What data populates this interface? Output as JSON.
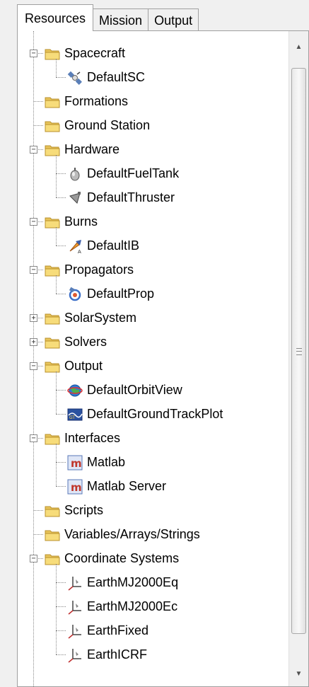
{
  "tabs": [
    "Resources",
    "Mission",
    "Output"
  ],
  "tree": [
    {
      "label": "Spacecraft",
      "icon": "folder-icon",
      "level": 0,
      "expanded": true
    },
    {
      "label": "DefaultSC",
      "icon": "satellite-icon",
      "level": 1
    },
    {
      "label": "Formations",
      "icon": "folder-icon",
      "level": 0
    },
    {
      "label": "Ground Station",
      "icon": "folder-icon",
      "level": 0
    },
    {
      "label": "Hardware",
      "icon": "folder-icon",
      "level": 0,
      "expanded": true
    },
    {
      "label": "DefaultFuelTank",
      "icon": "fuel-tank-icon",
      "level": 1
    },
    {
      "label": "DefaultThruster",
      "icon": "thruster-icon",
      "level": 1
    },
    {
      "label": "Burns",
      "icon": "folder-icon",
      "level": 0,
      "expanded": true
    },
    {
      "label": "DefaultIB",
      "icon": "impulsive-burn-icon",
      "level": 1
    },
    {
      "label": "Propagators",
      "icon": "folder-icon",
      "level": 0,
      "expanded": true
    },
    {
      "label": "DefaultProp",
      "icon": "propagator-icon",
      "level": 1
    },
    {
      "label": "SolarSystem",
      "icon": "folder-icon",
      "level": 0,
      "expanded": false
    },
    {
      "label": "Solvers",
      "icon": "folder-icon",
      "level": 0,
      "expanded": false
    },
    {
      "label": "Output",
      "icon": "folder-icon",
      "level": 0,
      "expanded": true
    },
    {
      "label": "DefaultOrbitView",
      "icon": "orbit-view-icon",
      "level": 1
    },
    {
      "label": "DefaultGroundTrackPlot",
      "icon": "ground-track-icon",
      "level": 1
    },
    {
      "label": "Interfaces",
      "icon": "folder-icon",
      "level": 0,
      "expanded": true
    },
    {
      "label": "Matlab",
      "icon": "matlab-icon",
      "level": 1
    },
    {
      "label": "Matlab Server",
      "icon": "matlab-icon",
      "level": 1
    },
    {
      "label": "Scripts",
      "icon": "folder-icon",
      "level": 0
    },
    {
      "label": "Variables/Arrays/Strings",
      "icon": "folder-icon",
      "level": 0
    },
    {
      "label": "Coordinate Systems",
      "icon": "folder-icon",
      "level": 0,
      "expanded": true
    },
    {
      "label": "EarthMJ2000Eq",
      "icon": "coordinate-axes-icon",
      "level": 1
    },
    {
      "label": "EarthMJ2000Ec",
      "icon": "coordinate-axes-icon",
      "level": 1
    },
    {
      "label": "EarthFixed",
      "icon": "coordinate-axes-icon",
      "level": 1
    },
    {
      "label": "EarthICRF",
      "icon": "coordinate-axes-icon",
      "level": 1
    }
  ]
}
